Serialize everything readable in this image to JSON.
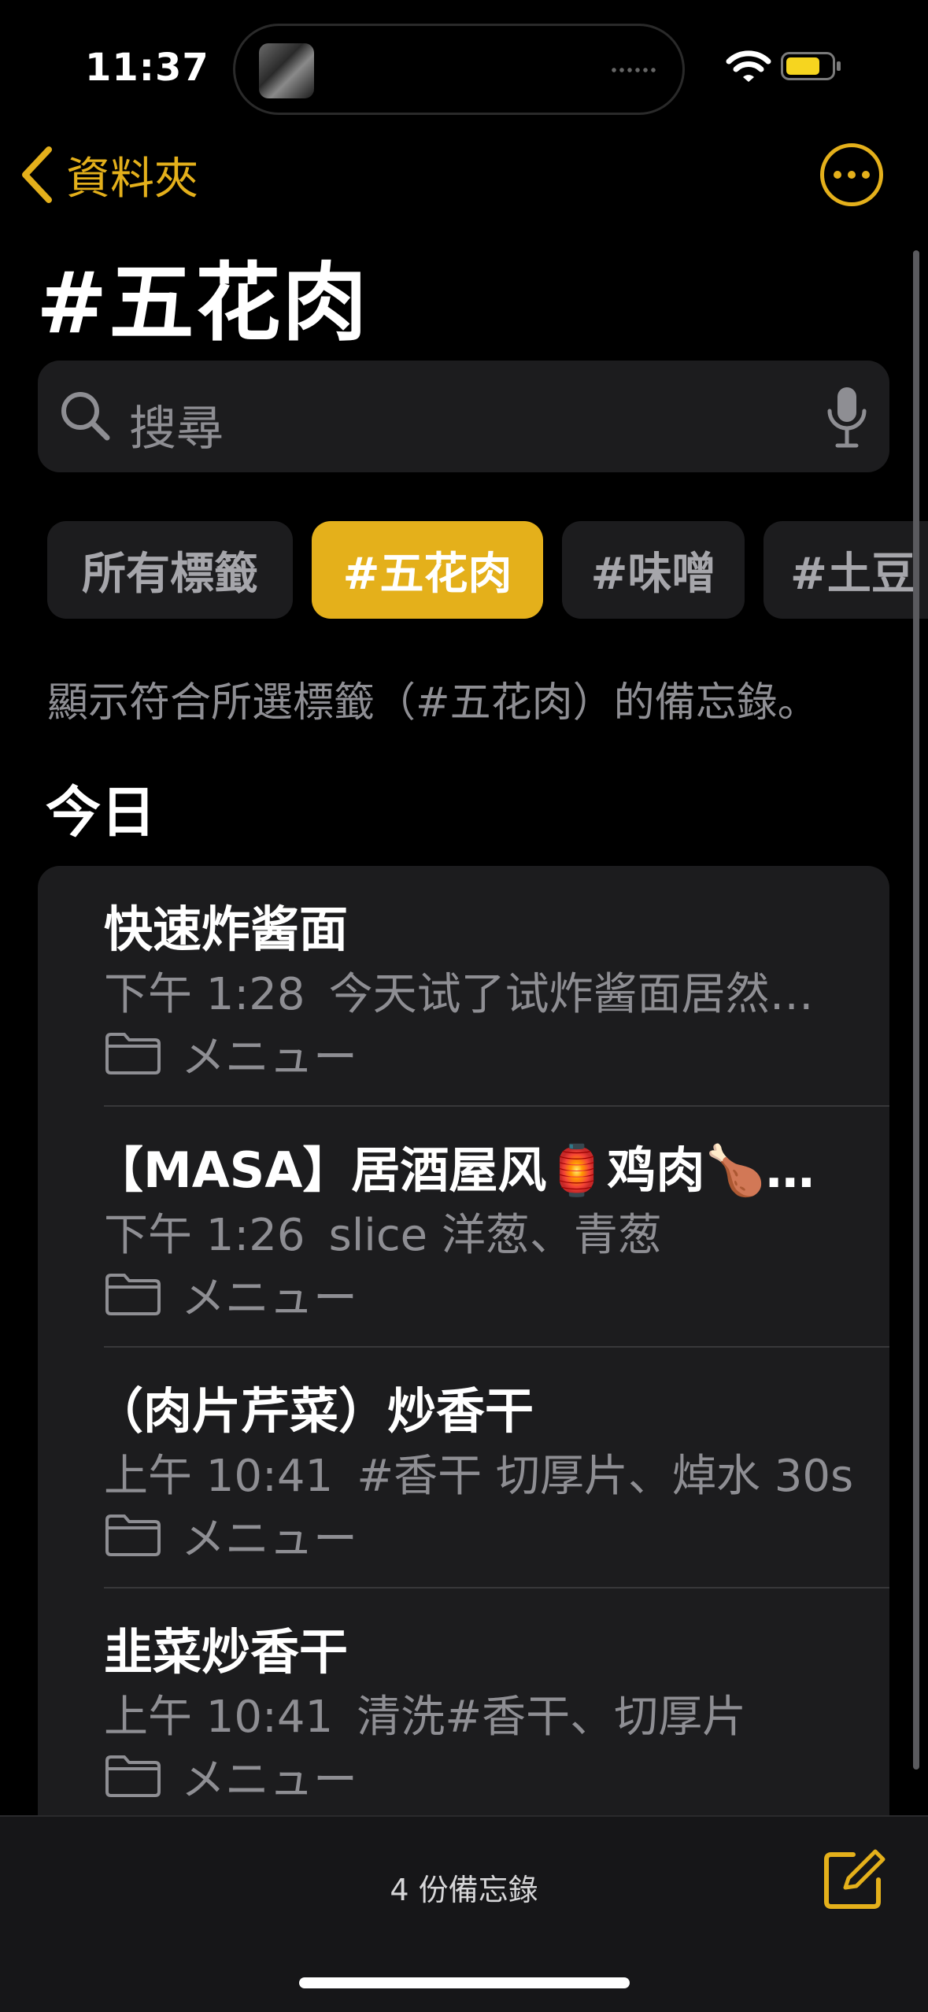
{
  "status_bar": {
    "time": "11:37"
  },
  "nav": {
    "back_label": "資料夾",
    "title": "#五花肉"
  },
  "search": {
    "placeholder": "搜尋"
  },
  "tags": [
    {
      "label": "所有標籤",
      "selected": false
    },
    {
      "label": "#五花肉",
      "selected": true
    },
    {
      "label": "#味噌",
      "selected": false
    },
    {
      "label": "#土豆",
      "selected": false
    }
  ],
  "filter_description": "顯示符合所選標籤（#五花肉）的備忘錄。",
  "section_header": "今日",
  "notes": [
    {
      "title": "快速炸酱面",
      "time": "下午 1:28",
      "preview": "今天试了试炸酱面居然…",
      "folder": "メニュー"
    },
    {
      "title": "【MASA】居酒屋风🏮鸡肉🍗…",
      "time": "下午 1:26",
      "preview": "slice 洋葱、青葱",
      "folder": "メニュー"
    },
    {
      "title": "（肉片芹菜）炒香干",
      "time": "上午 10:41",
      "preview": "#香干 切厚片、焯水 30s",
      "folder": "メニュー"
    },
    {
      "title": "韭菜炒香干",
      "time": "上午 10:41",
      "preview": "清洗#香干、切厚片",
      "folder": "メニュー"
    }
  ],
  "toolbar": {
    "note_count": "4 份備忘錄"
  },
  "colors": {
    "accent": "#E4B01B",
    "background": "#000000",
    "card": "#1C1C1E",
    "secondary_text": "#8E8E93"
  }
}
